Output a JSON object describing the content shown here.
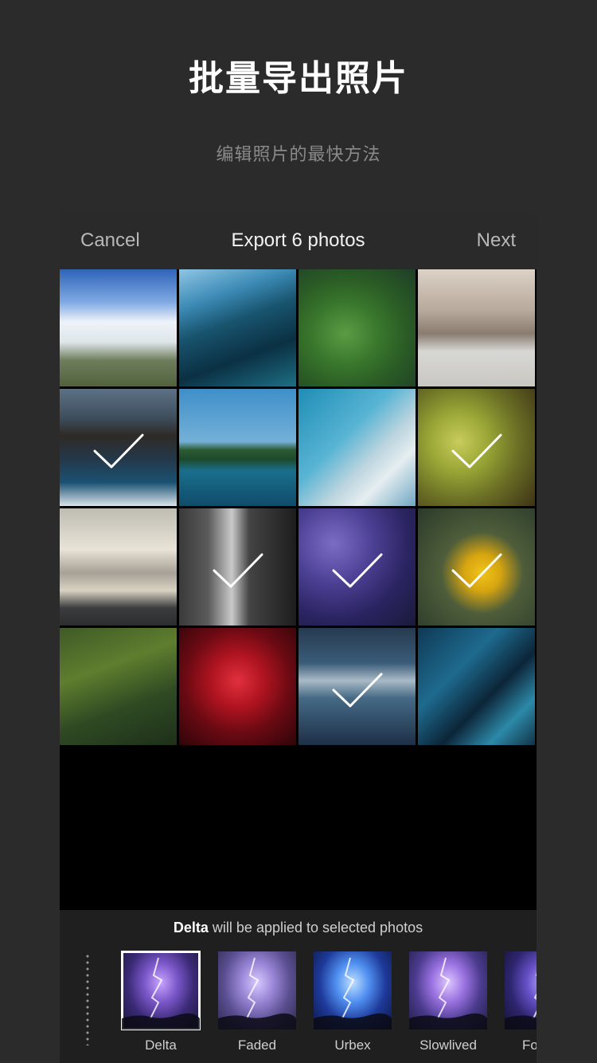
{
  "hero": {
    "title": "批量导出照片",
    "subtitle": "编辑照片的最快方法"
  },
  "nav": {
    "cancel": "Cancel",
    "title": "Export 6 photos",
    "next": "Next"
  },
  "photos": [
    {
      "subject": "waterfall-landscape",
      "selected": false
    },
    {
      "subject": "underwater-swimmer",
      "selected": false
    },
    {
      "subject": "green-valley-aerial",
      "selected": false
    },
    {
      "subject": "jumping-feet",
      "selected": false
    },
    {
      "subject": "rocky-coast-waves",
      "selected": true
    },
    {
      "subject": "hot-air-balloon-lake",
      "selected": false
    },
    {
      "subject": "skyscraper",
      "selected": false
    },
    {
      "subject": "green-apples",
      "selected": true
    },
    {
      "subject": "vintage-car",
      "selected": false
    },
    {
      "subject": "bw-waterfall",
      "selected": true
    },
    {
      "subject": "lightning-storm",
      "selected": true
    },
    {
      "subject": "yellow-flower",
      "selected": true
    },
    {
      "subject": "forest-hillside",
      "selected": false
    },
    {
      "subject": "cherries",
      "selected": false
    },
    {
      "subject": "ocean-wave",
      "selected": true
    },
    {
      "subject": "spiral-staircase",
      "selected": false
    }
  ],
  "applied": {
    "filter_name": "Delta",
    "suffix": "will be applied to selected photos"
  },
  "filters": [
    {
      "label": "Delta",
      "selected": true
    },
    {
      "label": "Faded",
      "selected": false
    },
    {
      "label": "Urbex",
      "selected": false
    },
    {
      "label": "Slowlived",
      "selected": false
    },
    {
      "label": "Fo",
      "selected": false
    }
  ],
  "colors": {
    "background": "#2b2b2b",
    "panel": "#2a2a2a",
    "checkmark": "#ffffff"
  }
}
